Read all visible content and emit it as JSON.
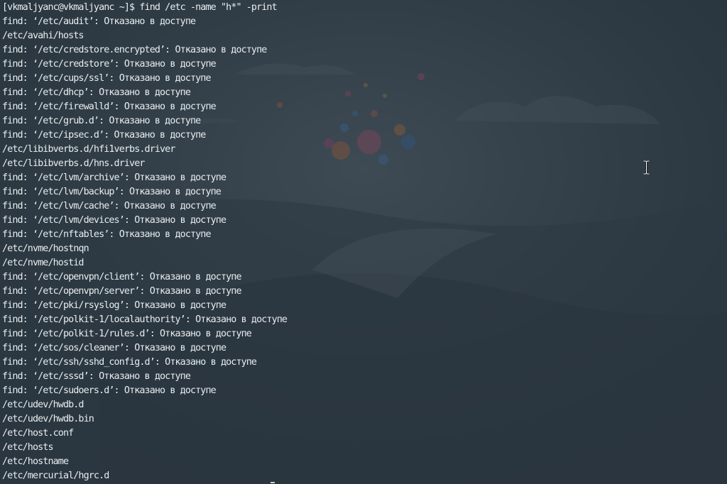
{
  "terminal": {
    "lines": [
      "[vkmaljyanc@vkmaljyanc ~]$ find /etc -name \"h*\" -print",
      "find: ‘/etc/audit’: Отказано в доступе",
      "/etc/avahi/hosts",
      "find: ‘/etc/credstore.encrypted’: Отказано в доступе",
      "find: ‘/etc/credstore’: Отказано в доступе",
      "find: ‘/etc/cups/ssl’: Отказано в доступе",
      "find: ‘/etc/dhcp’: Отказано в доступе",
      "find: ‘/etc/firewalld’: Отказано в доступе",
      "find: ‘/etc/grub.d’: Отказано в доступе",
      "find: ‘/etc/ipsec.d’: Отказано в доступе",
      "/etc/libibverbs.d/hfi1verbs.driver",
      "/etc/libibverbs.d/hns.driver",
      "find: ‘/etc/lvm/archive’: Отказано в доступе",
      "find: ‘/etc/lvm/backup’: Отказано в доступе",
      "find: ‘/etc/lvm/cache’: Отказано в доступе",
      "find: ‘/etc/lvm/devices’: Отказано в доступе",
      "find: ‘/etc/nftables’: Отказано в доступе",
      "/etc/nvme/hostnqn",
      "/etc/nvme/hostid",
      "find: ‘/etc/openvpn/client’: Отказано в доступе",
      "find: ‘/etc/openvpn/server’: Отказано в доступе",
      "find: ‘/etc/pki/rsyslog’: Отказано в доступе",
      "find: ‘/etc/polkit-1/localauthority’: Отказано в доступе",
      "find: ‘/etc/polkit-1/rules.d’: Отказано в доступе",
      "find: ‘/etc/sos/cleaner’: Отказано в доступе",
      "find: ‘/etc/ssh/sshd_config.d’: Отказано в доступе",
      "find: ‘/etc/sssd’: Отказано в доступе",
      "find: ‘/etc/sudoers.d’: Отказано в доступе",
      "/etc/udev/hwdb.d",
      "/etc/udev/hwdb.bin",
      "/etc/host.conf",
      "/etc/hosts",
      "/etc/hostname",
      "/etc/mercurial/hgrc.d"
    ]
  },
  "colors": {
    "background": "#2b3943",
    "text": "#e9edf0"
  },
  "icons": {
    "mouse_cursor": "ibeam-cursor-icon"
  }
}
